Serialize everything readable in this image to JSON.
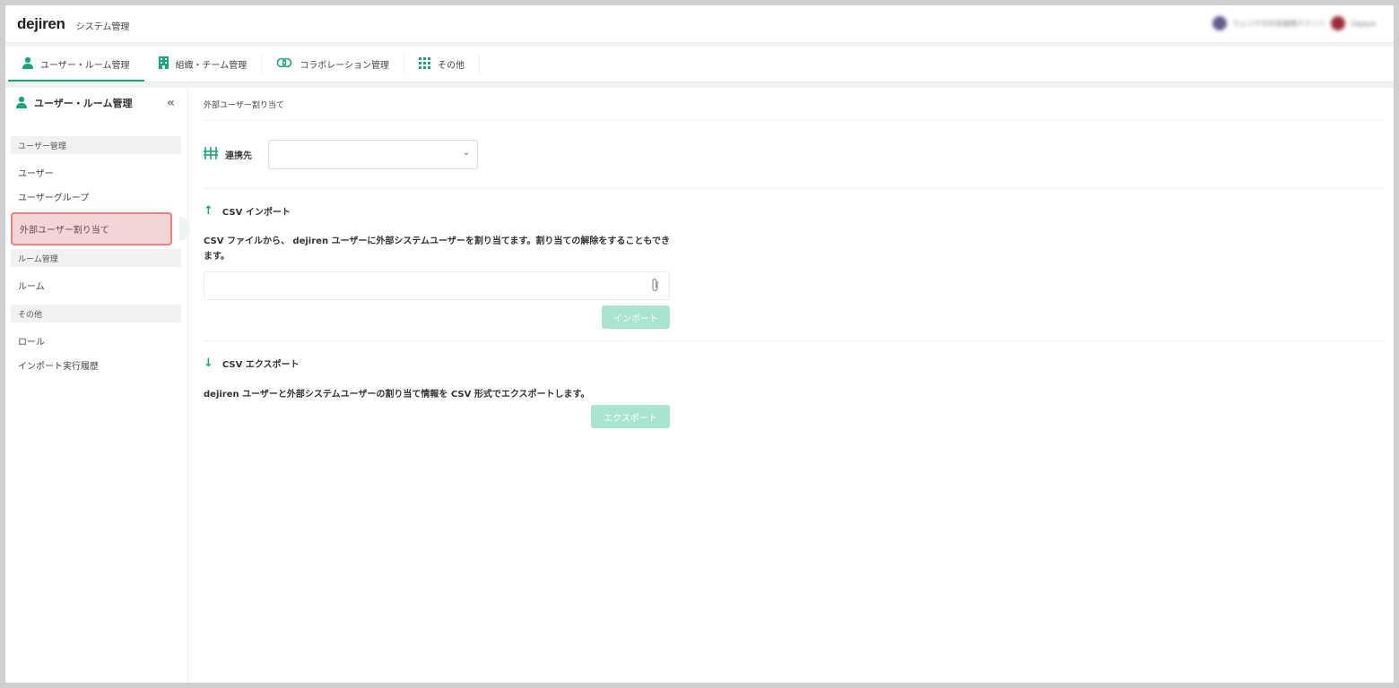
{
  "header": {
    "logo": "dejiren",
    "app_title": "システム管理",
    "user_org": "ウェジテの外部連携テナント",
    "user_name": "tagaya"
  },
  "tabs": [
    {
      "label": "ユーザー・ルーム管理",
      "icon": "user-icon",
      "active": true
    },
    {
      "label": "組織・チーム管理",
      "icon": "building-icon",
      "active": false
    },
    {
      "label": "コラボレーション管理",
      "icon": "link-icon",
      "active": false
    },
    {
      "label": "その他",
      "icon": "grid-icon",
      "active": false
    }
  ],
  "sidebar": {
    "title": "ユーザー・ルーム管理",
    "collapse_glyph": "«",
    "sections": [
      {
        "header": "ユーザー管理",
        "items": [
          "ユーザー",
          "ユーザーグループ",
          "外部ユーザー割り当て"
        ]
      },
      {
        "header": "ルーム管理",
        "items": [
          "ルーム"
        ]
      },
      {
        "header": "その他",
        "items": [
          "ロール",
          "インポート実行履歴"
        ]
      }
    ],
    "active_item": "外部ユーザー割り当て"
  },
  "main": {
    "page_title": "外部ユーザー割り当て",
    "link_label": "連携先",
    "link_value": "",
    "import": {
      "title": "CSV インポート",
      "description": "CSV ファイルから、 dejiren ユーザーに外部システムユーザーを割り当てます。割り当ての解除をすることもできます。",
      "button": "インポート"
    },
    "export": {
      "title": "CSV エクスポート",
      "description": "dejiren ユーザーと外部システムユーザーの割り当て情報を CSV 形式でエクスポートします。",
      "button": "エクスポート"
    }
  },
  "colors": {
    "accent": "#1aa67d",
    "button_disabled": "#a9e4d2",
    "highlight_border": "#ee7f7f",
    "highlight_fill": "#f2d6d6"
  }
}
